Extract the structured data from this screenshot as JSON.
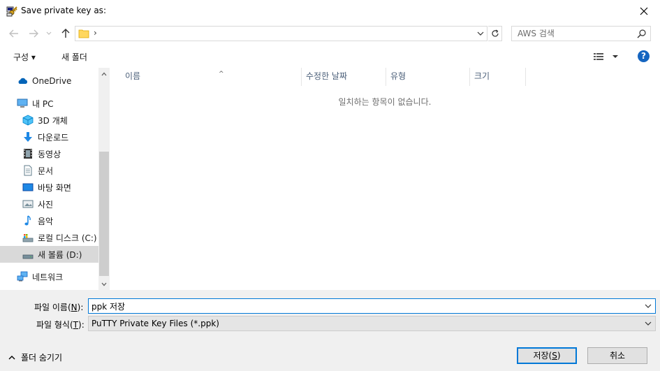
{
  "window": {
    "title": "Save private key as:"
  },
  "nav": {
    "address_chevron": "›",
    "search_placeholder": "AWS 검색"
  },
  "toolbar": {
    "organize_label": "구성 ▾",
    "new_folder_label": "새 폴더",
    "help_label": "?"
  },
  "tree": {
    "items": [
      {
        "label": "OneDrive",
        "icon": "onedrive-cloud-icon"
      },
      {
        "label": "내 PC",
        "icon": "computer-icon"
      },
      {
        "label": "3D 개체",
        "icon": "3d-objects-icon"
      },
      {
        "label": "다운로드",
        "icon": "download-arrow-icon"
      },
      {
        "label": "동영상",
        "icon": "video-icon"
      },
      {
        "label": "문서",
        "icon": "document-icon"
      },
      {
        "label": "바탕 화면",
        "icon": "desktop-icon"
      },
      {
        "label": "사진",
        "icon": "pictures-icon"
      },
      {
        "label": "음악",
        "icon": "music-note-icon"
      },
      {
        "label": "로컬 디스크 (C:)",
        "icon": "local-disk-icon"
      },
      {
        "label": "새 볼륨 (D:)",
        "icon": "drive-icon",
        "selected": true
      },
      {
        "label": "네트워크",
        "icon": "network-icon"
      }
    ]
  },
  "filelist": {
    "columns": [
      "이름",
      "수정한 날짜",
      "유형",
      "크기"
    ],
    "sort_indicator": "^",
    "empty_message": "일치하는 항목이 없습니다."
  },
  "bottom": {
    "filename_label_prefix": "파일 이름(",
    "filename_label_key": "N",
    "filename_label_suffix": "):",
    "filename_value": "ppk 저장",
    "filetype_label_prefix": "파일 형식(",
    "filetype_label_key": "T",
    "filetype_label_suffix": "):",
    "filetype_value": "PuTTY Private Key Files (*.ppk)",
    "hide_folders_label": "폴더 숨기기",
    "save_prefix": "저장(",
    "save_key": "S",
    "save_suffix": ")",
    "cancel_label": "취소"
  },
  "colors": {
    "accent": "#0078d7",
    "selected_row": "#d9d9d9",
    "help_blue": "#1565c0"
  }
}
